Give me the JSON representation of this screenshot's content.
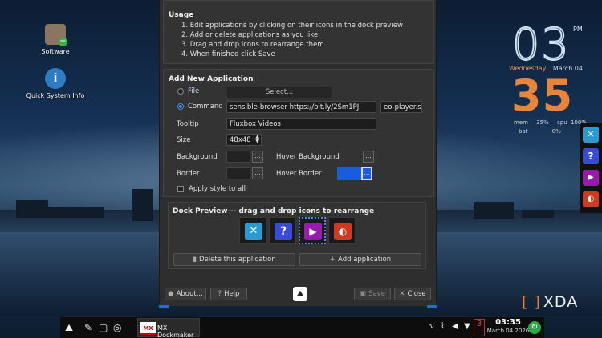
{
  "desktop": {
    "icons": [
      {
        "label": "Software",
        "icon": "software-box-icon",
        "color": "#8a7560"
      },
      {
        "label": "Quick System Info",
        "icon": "info-icon",
        "color": "#2e7cc4"
      }
    ]
  },
  "clock_widget": {
    "hour": "03",
    "meridiem": "PM",
    "date_day": "Wednesday",
    "date_month": "March 04",
    "minute": "35",
    "stats": {
      "mem_label": "mem",
      "mem_value": "35%",
      "cpu_label": "cpu",
      "cpu_value": "100%",
      "bat_label": "bat",
      "bat_value": "0%"
    }
  },
  "side_dock": {
    "items": [
      {
        "icon": "mx-tools-icon",
        "color": "#2a9ad0"
      },
      {
        "icon": "help-icon",
        "color": "#3a4ad8"
      },
      {
        "icon": "video-player-icon",
        "color": "#9a1ab0"
      },
      {
        "icon": "browser-icon",
        "color": "#d03a20"
      }
    ]
  },
  "usage": {
    "title": "Usage",
    "lines": [
      "1. Edit applications by clicking on their icons in the dock preview",
      "2. Add or delete applications as you like",
      "3. Drag and drop icons to rearrange them",
      "4. When finished click Save"
    ]
  },
  "add_app": {
    "title": "Add New Application",
    "file_label": "File",
    "select_button": "Select...",
    "command_label": "Command",
    "command_value": "sensible-browser https://bit.ly/2Sm1PJl",
    "icon_value": "eo-player.svg",
    "tooltip_label": "Tooltip",
    "tooltip_value": "Fluxbox Videos",
    "size_label": "Size",
    "size_value": "48x48",
    "background_label": "Background",
    "hover_background_label": "Hover Background",
    "border_label": "Border",
    "hover_border_label": "Hover Border",
    "hover_border_color": "#1a5ce0",
    "ellipsis": "...",
    "apply_all_label": "Apply style to all"
  },
  "dock_preview": {
    "title": "Dock Preview -- drag and drop icons to rearrange",
    "delete_button": "Delete this application",
    "add_button": "Add application",
    "tiles": [
      {
        "icon": "mx-tools-icon",
        "color": "#2a9ad0"
      },
      {
        "icon": "help-icon",
        "color": "#3a4ad8"
      },
      {
        "icon": "video-player-icon",
        "color": "#9a1ab0"
      },
      {
        "icon": "browser-icon",
        "color": "#d03a20"
      }
    ]
  },
  "footer": {
    "about_button": "About...",
    "help_button": "Help",
    "save_button": "Save",
    "close_button": "Close"
  },
  "taskbar": {
    "app_badge": "MX",
    "app_label": "MX Dockmaker",
    "updates_count": "3",
    "time": "03:35",
    "date": "March 04 2026"
  },
  "watermark": "XDA"
}
